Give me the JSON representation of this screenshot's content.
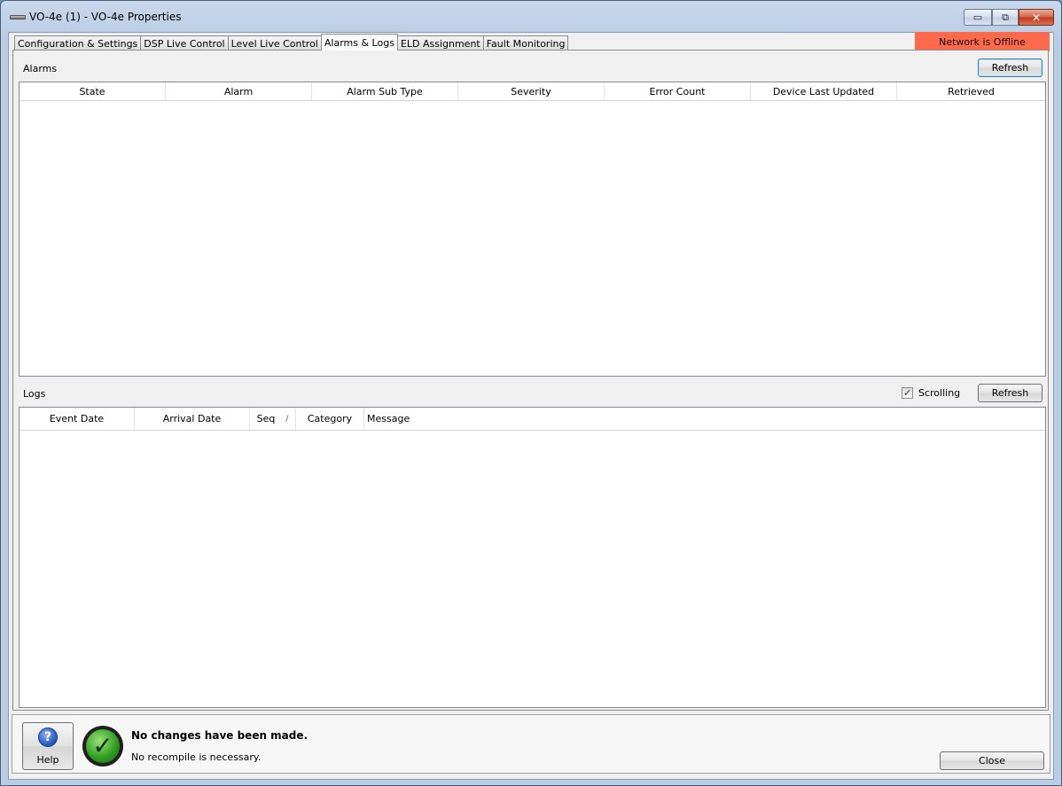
{
  "window": {
    "title": "VO-4e (1) - VO-4e Properties",
    "minimize_glyph": "▭",
    "maximize_glyph": "⧉",
    "close_glyph": "✕"
  },
  "tabs": [
    {
      "label": "Configuration & Settings",
      "active": false
    },
    {
      "label": "DSP Live Control",
      "active": false
    },
    {
      "label": "Level Live Control",
      "active": false
    },
    {
      "label": "Alarms & Logs",
      "active": true
    },
    {
      "label": "ELD Assignment",
      "active": false
    },
    {
      "label": "Fault Monitoring",
      "active": false
    }
  ],
  "network_status": {
    "text": "Network is Offline",
    "color": "#ff6a4d"
  },
  "alarms": {
    "label": "Alarms",
    "refresh_label": "Refresh",
    "columns": [
      "State",
      "Alarm",
      "Alarm Sub Type",
      "Severity",
      "Error Count",
      "Device Last Updated",
      "Retrieved"
    ],
    "rows": []
  },
  "logs": {
    "label": "Logs",
    "scrolling_label": "Scrolling",
    "scrolling_checked": true,
    "check_glyph": "✓",
    "refresh_label": "Refresh",
    "columns": [
      "Event Date",
      "Arrival Date",
      "Seq",
      "Category",
      "Message"
    ],
    "sort_glyph": "/",
    "rows": []
  },
  "footer": {
    "help_icon_glyph": "?",
    "help_label": "Help",
    "status_glyph": "✓",
    "status_title": "No changes have been made.",
    "status_detail": "No recompile is necessary.",
    "close_label": "Close"
  }
}
